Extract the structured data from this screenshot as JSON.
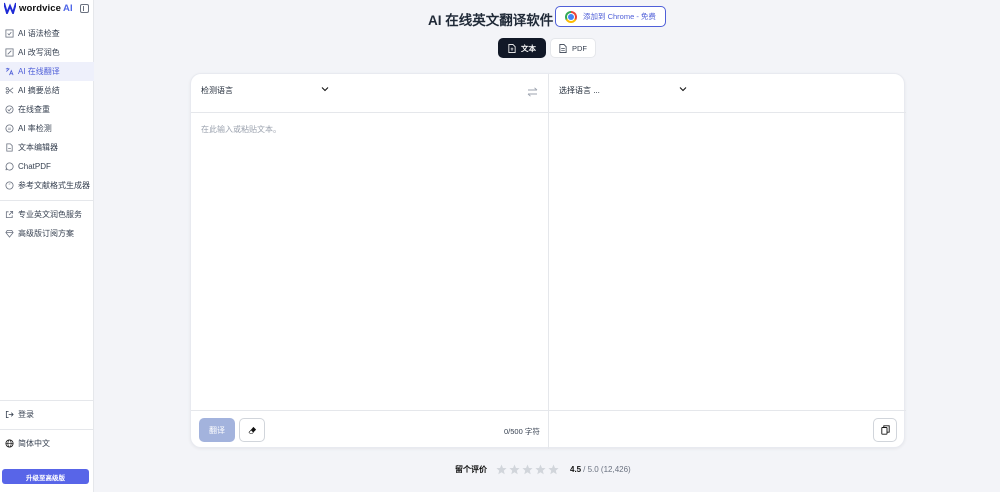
{
  "brand": {
    "name": "wordvice",
    "suffix": "AI"
  },
  "sidebar": {
    "items": [
      {
        "label": "AI 语法检查",
        "icon": "grammar-icon",
        "active": false
      },
      {
        "label": "AI 改写润色",
        "icon": "rewrite-icon",
        "active": false
      },
      {
        "label": "AI 在线翻译",
        "icon": "translate-icon",
        "active": true
      },
      {
        "label": "AI 摘要总结",
        "icon": "summary-icon",
        "active": false
      },
      {
        "label": "在线查重",
        "icon": "plagiarism-icon",
        "active": false
      },
      {
        "label": "AI 率检测",
        "icon": "ai-detector-icon",
        "active": false
      },
      {
        "label": "文本编辑器",
        "icon": "editor-icon",
        "active": false
      },
      {
        "label": "ChatPDF",
        "icon": "chat-icon",
        "active": false
      },
      {
        "label": "参考文献格式生成器",
        "icon": "citation-icon",
        "active": false
      }
    ],
    "secondary": [
      {
        "label": "专业英文润色服务",
        "icon": "external-link-icon"
      },
      {
        "label": "高级版订阅方案",
        "icon": "diamond-icon"
      }
    ],
    "login": "登录",
    "language": "简体中文",
    "upgrade": "升级至高级版"
  },
  "header": {
    "title": "AI 在线英文翻译软件",
    "chrome_button": "添加到 Chrome - 免费"
  },
  "tabs": [
    {
      "label": "文本",
      "active": true
    },
    {
      "label": "PDF",
      "active": false
    }
  ],
  "translator": {
    "source_lang": "检测语言",
    "target_lang": "选择语言 ...",
    "placeholder": "在此输入或粘贴文本。",
    "translate_button": "翻译",
    "char_count": "0/500 字符"
  },
  "rating": {
    "label": "留个评价",
    "score": "4.5",
    "rest": "/ 5.0 (12,426)",
    "stars": 5
  },
  "colors": {
    "accent": "#4f5fd8",
    "upgrade": "#5865e8",
    "translate_btn": "#a3b3dd"
  }
}
